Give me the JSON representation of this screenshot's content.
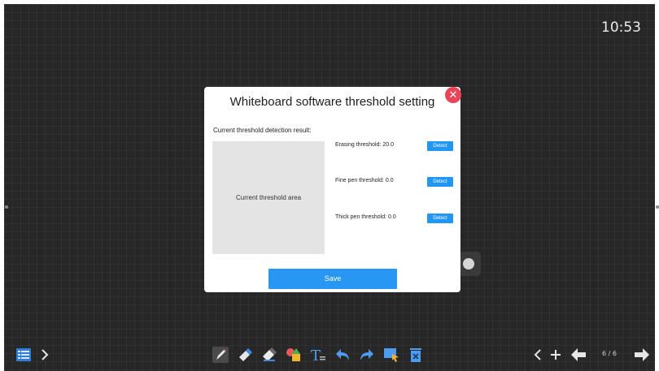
{
  "status": {
    "time": "10:53"
  },
  "dialog": {
    "title": "Whiteboard software threshold setting",
    "close_icon": "close-icon",
    "result_label": "Current threshold detection result:",
    "area_label": "Current threshold area",
    "rows": [
      {
        "label": "Erasing threshold: 20.0",
        "button": "Detect"
      },
      {
        "label": "Fine pen threshold: 0.0",
        "button": "Detect"
      },
      {
        "label": "Thick pen threshold: 0.0",
        "button": "Detect"
      }
    ],
    "save_label": "Save",
    "colors": {
      "accent": "#2296f3",
      "close": "#e8455a"
    }
  },
  "toolbar": {
    "left": [
      "menu-icon",
      "chevron-right-icon"
    ],
    "center": [
      "pen-icon",
      "eraser-icon",
      "area-eraser-icon",
      "shapes-icon",
      "text-icon",
      "undo-icon",
      "redo-icon",
      "select-icon",
      "clear-icon"
    ],
    "right": [
      "previous-page-icon",
      "add-page-icon",
      "page-back-icon",
      "page-forward-icon"
    ],
    "page": "6 / 6"
  }
}
